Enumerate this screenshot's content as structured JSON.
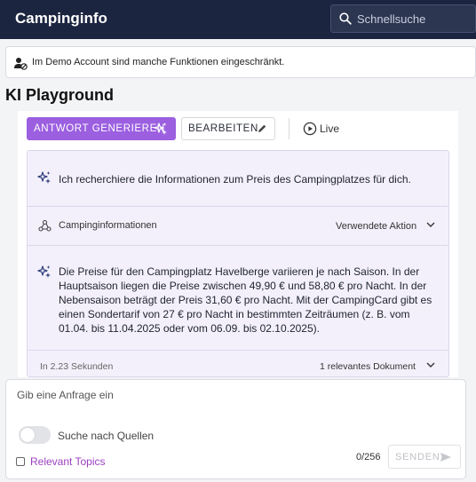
{
  "app": {
    "title": "Campinginfo",
    "search_placeholder": "Schnellsuche"
  },
  "notice": {
    "text": "Im Demo Account sind manche Funktionen eingeschränkt."
  },
  "page": {
    "title": "KI Playground"
  },
  "toolbar": {
    "generate_label": "ANTWORT GENERIEREN",
    "edit_label": "BEARBEITEN",
    "live_label": "Live"
  },
  "response": {
    "intro": "Ich recherchiere die Informationen zum Preis des Campingplatzes für dich.",
    "action_title": "Campinginformationen",
    "action_label": "Verwendete Aktion",
    "answer": "Die Preise für den Campingplatz Havelberge variieren je nach Saison. In der Hauptsaison liegen die Preise zwischen 49,90 € und 58,80 € pro Nacht. In der Nebensaison beträgt der Preis 31,60 € pro Nacht. Mit der CampingCard gibt es einen Sondertarif von 27 € pro Nacht in bestimmten Zeiträumen (z. B. vom 01.04. bis 11.04.2025 oder vom 06.09. bis 02.10.2025).",
    "duration": "In 2.23 Sekunden",
    "documents": "1 relevantes Dokument"
  },
  "composer": {
    "placeholder": "Gib eine Anfrage ein",
    "toggle_label": "Suche nach Quellen",
    "toggle_on": false,
    "topics_label": "Relevant Topics",
    "counter": "0/256",
    "send_label": "SENDEN"
  },
  "colors": {
    "header": "#1c2540",
    "accent": "#9b5fe0",
    "card_bg": "#f3f0fb",
    "link": "#9b3fc0"
  }
}
